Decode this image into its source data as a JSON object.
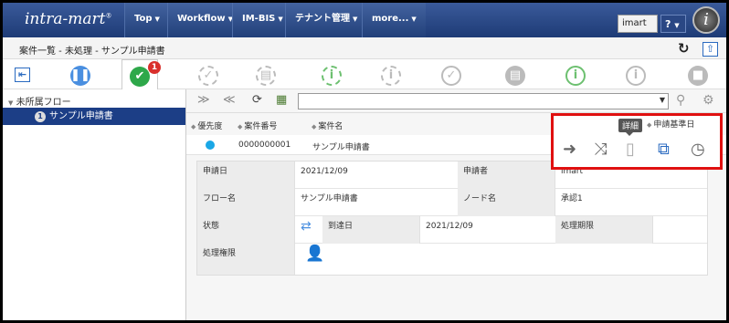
{
  "header": {
    "logo": "intra-mart",
    "nav": [
      {
        "label": "Top"
      },
      {
        "label": "Workflow"
      },
      {
        "label": "IM-BIS"
      },
      {
        "label": "テナント管理"
      },
      {
        "label": "more..."
      }
    ],
    "user": "imart",
    "help": "?"
  },
  "breadcrumb": "案件一覧 - 未処理 - サンプル申請書",
  "toolbar": {
    "badge_count": "1"
  },
  "sidebar": {
    "root_label": "未所属フロー",
    "item_count": "1",
    "item_label": "サンプル申請書"
  },
  "table": {
    "columns": [
      "優先度",
      "案件番号",
      "案件名"
    ],
    "row": {
      "number": "0000000001",
      "name": "サンプル申請書"
    }
  },
  "detail": {
    "apply_date_label": "申請日",
    "apply_date": "2021/12/09",
    "applicant_label": "申請者",
    "applicant": "imart",
    "flow_label": "フロー名",
    "flow": "サンプル申請書",
    "node_label": "ノード名",
    "node": "承認1",
    "status_label": "状態",
    "arrival_label": "到達日",
    "arrival": "2021/12/09",
    "deadline_label": "処理期限",
    "deadline": "",
    "authority_label": "処理権限"
  },
  "highlight": {
    "tooltip": "詳細",
    "header": "申請基準日"
  },
  "colors": {
    "header_bg": "#1e3b76",
    "selected_row": "#1c3e86",
    "highlight_border": "#e01010",
    "status_dot": "#1aa7e6"
  }
}
